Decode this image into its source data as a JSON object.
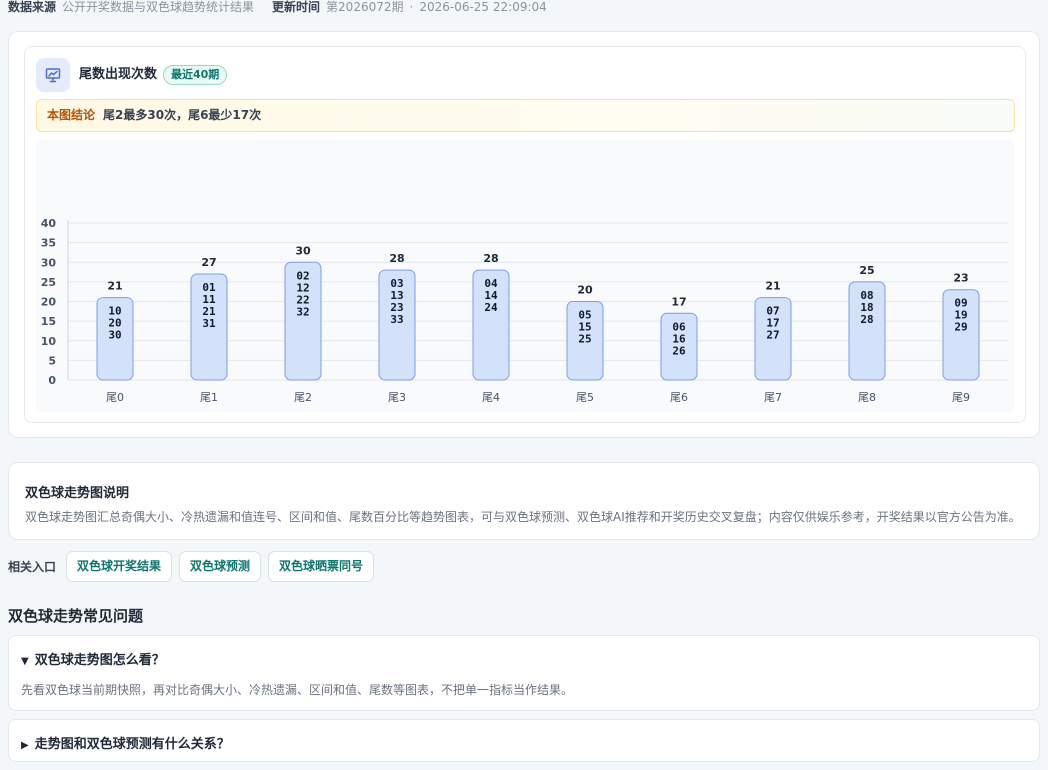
{
  "meta": {
    "source_label": "数据来源",
    "source_value": "公开开奖数据与双色球趋势统计结果",
    "update_label": "更新时间",
    "issue": "第2026072期",
    "separator": "·",
    "datetime": "2026-06-25 22:09:04"
  },
  "card": {
    "icon": "presentation-chart-icon",
    "title": "尾数出现次数",
    "badge": "最近40期",
    "conclusion_label": "本图结论",
    "conclusion_text": "尾2最多30次，尾6最少17次"
  },
  "chart_data": {
    "type": "bar",
    "categories": [
      "尾0",
      "尾1",
      "尾2",
      "尾3",
      "尾4",
      "尾5",
      "尾6",
      "尾7",
      "尾8",
      "尾9"
    ],
    "values": [
      21,
      27,
      30,
      28,
      28,
      20,
      17,
      21,
      25,
      23
    ],
    "bar_labels": [
      [
        "10",
        "20",
        "30"
      ],
      [
        "01",
        "11",
        "21",
        "31"
      ],
      [
        "02",
        "12",
        "22",
        "32"
      ],
      [
        "03",
        "13",
        "23",
        "33"
      ],
      [
        "04",
        "14",
        "24"
      ],
      [
        "05",
        "15",
        "25"
      ],
      [
        "06",
        "16",
        "26"
      ],
      [
        "07",
        "17",
        "27"
      ],
      [
        "08",
        "18",
        "28"
      ],
      [
        "09",
        "19",
        "29"
      ]
    ],
    "yticks": [
      0,
      5,
      10,
      15,
      20,
      25,
      30,
      35,
      40
    ],
    "ylim": [
      0,
      40
    ],
    "grid": true,
    "colors": {
      "bar_fill": "#d3e1fa",
      "bar_stroke": "#7d9ee4",
      "grid": "#e3e8ef",
      "label": "#1f2937",
      "axis": "#475569"
    }
  },
  "description": {
    "title": "双色球走势图说明",
    "text": "双色球走势图汇总奇偶大小、冷热遗漏和值连号、区间和值、尾数百分比等趋势图表，可与双色球预测、双色球AI推荐和开奖历史交叉复盘；内容仅供娱乐参考，开奖结果以官方公告为准。"
  },
  "related": {
    "label": "相关入口",
    "links": [
      "双色球开奖结果",
      "双色球预测",
      "双色球晒票同号"
    ]
  },
  "faq": {
    "title": "双色球走势常见问题",
    "items": [
      {
        "open_marker": "▼",
        "question": "双色球走势图怎么看？",
        "answer": "先看双色球当前期快照，再对比奇偶大小、冷热遗漏、区间和值、尾数等图表，不把单一指标当作结果。"
      },
      {
        "open_marker": "▶",
        "question": "走势图和双色球预测有什么关系？"
      }
    ]
  },
  "theme": {
    "accent": "#0f766e",
    "page_bg": "#f4f7fa",
    "highlight": "#b45309"
  }
}
